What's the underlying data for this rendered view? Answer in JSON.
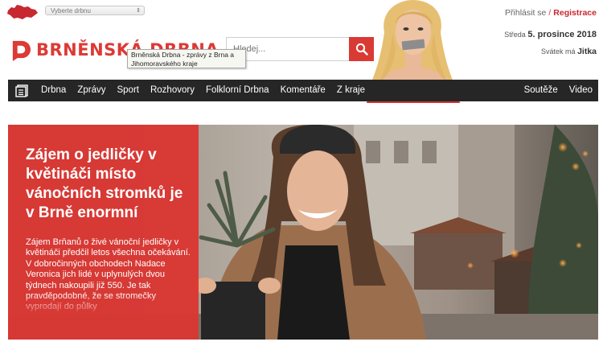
{
  "top": {
    "region_select": {
      "value": "Vyberte drbnu"
    }
  },
  "brand": {
    "name": "BRNĚNSKÁ DRBNA",
    "tooltip": "Brněnská Drbna - zprávy z Brna a Jihomoravského kraje"
  },
  "search": {
    "placeholder": "Hledej..."
  },
  "auth": {
    "login": "Přihlásit se",
    "separator": "/",
    "register": "Registrace"
  },
  "info": {
    "day_name": "Středa",
    "date": "5. prosince 2018",
    "nameday_prefix": "Svátek má",
    "nameday_name": "Jitka"
  },
  "nav": {
    "items": [
      {
        "label": "Drbna"
      },
      {
        "label": "Zprávy"
      },
      {
        "label": "Sport"
      },
      {
        "label": "Rozhovory"
      },
      {
        "label": "Folklorní Drbna"
      },
      {
        "label": "Komentáře"
      },
      {
        "label": "Z kraje"
      }
    ],
    "right_items": [
      {
        "label": "Soutěže"
      },
      {
        "label": "Video"
      }
    ]
  },
  "hero": {
    "title": "Zájem o jedličky v květináči místo vánočních stromků je v Brně enormní",
    "perex": "Zájem Brňanů o živé vánoční jedličky v květináči předčil letos všechna očekávání. V dobročinných obchodech Nadace Veronica jich lidé v uplynulých dvou týdnech nakoupili již 550. Je tak pravděpodobné, že se stromečky vyprodají do půlky"
  },
  "colors": {
    "brand_red": "#dc3a36",
    "nav_bg": "#262626",
    "hero_panel": "#da3632"
  },
  "icons": {
    "region_map": "czech-map-icon",
    "search": "search-icon",
    "menu": "menu-icon"
  }
}
